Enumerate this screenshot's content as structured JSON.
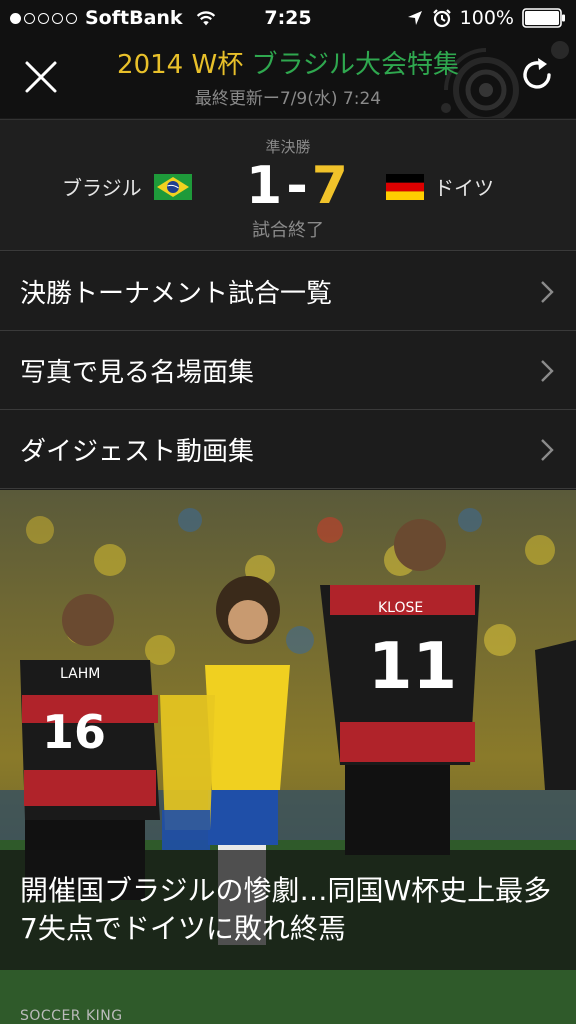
{
  "status_bar": {
    "carrier": "SoftBank",
    "time": "7:25",
    "battery": "100%",
    "signal_bars_filled": 1,
    "signal_bars_total": 5
  },
  "header": {
    "title_year": "2014 W杯",
    "title_event": "ブラジル大会特集",
    "last_updated": "最終更新ー7/9(水) 7:24",
    "close_icon": "close-icon",
    "refresh_icon": "refresh-icon"
  },
  "match": {
    "round": "準決勝",
    "home_team": "ブラジル",
    "away_team": "ドイツ",
    "home_score": "1",
    "separator": "-",
    "away_score": "7",
    "status": "試合終了",
    "home_flag": "brazil-flag-icon",
    "away_flag": "germany-flag-icon"
  },
  "menu": {
    "items": [
      {
        "label": "決勝トーナメント試合一覧"
      },
      {
        "label": "写真で見る名場面集"
      },
      {
        "label": "ダイジェスト動画集"
      }
    ]
  },
  "article": {
    "headline": "開催国ブラジルの惨劇…同国W杯史上最多7失点でドイツに敗れ終焉",
    "source": "SOCCER KING",
    "player_numbers": [
      "16",
      "11"
    ],
    "player_names": [
      "LAHM",
      "KLOSE"
    ]
  },
  "colors": {
    "accent_yellow": "#f0c22a",
    "accent_green": "#2fa84f",
    "background": "#1c1c1c"
  }
}
